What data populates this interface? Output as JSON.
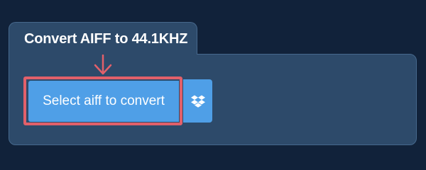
{
  "panel": {
    "title": "Convert AIFF to 44.1KHZ"
  },
  "upload": {
    "select_label": "Select aiff to convert",
    "select_icon": "none",
    "dropbox_icon": "dropbox-icon"
  },
  "annotation": {
    "arrow_icon": "arrow-down-icon",
    "highlight_color": "#e2606a"
  },
  "colors": {
    "background": "#11223a",
    "panel": "#2d4a6a",
    "button": "#4f9fe7",
    "accent": "#e2606a"
  }
}
